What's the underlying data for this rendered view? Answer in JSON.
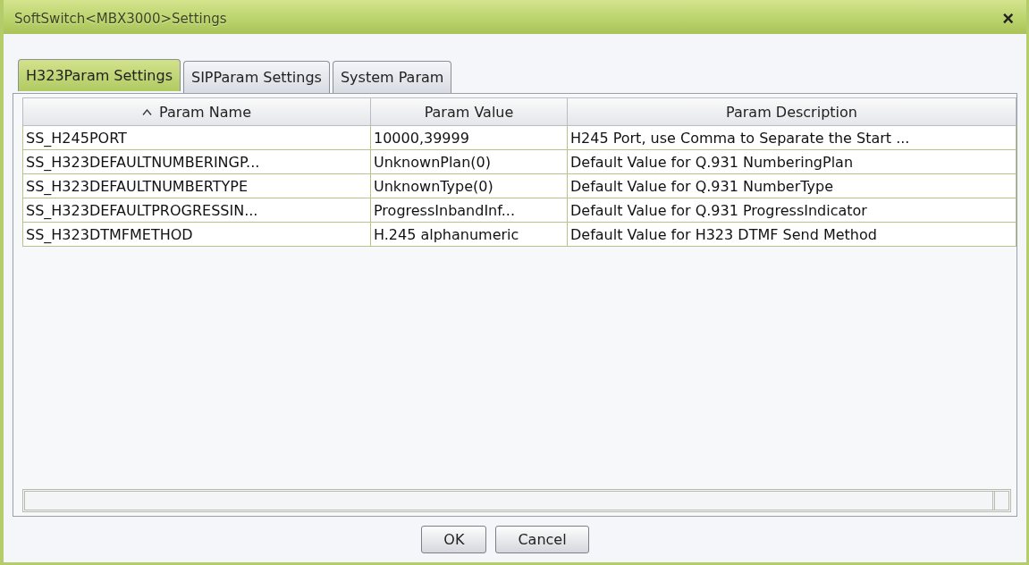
{
  "window": {
    "title": "SoftSwitch<MBX3000>Settings",
    "close": "×"
  },
  "tabs": [
    {
      "label": "H323Param Settings",
      "selected": true
    },
    {
      "label": "SIPParam Settings",
      "selected": false
    },
    {
      "label": "System Param",
      "selected": false
    }
  ],
  "table": {
    "columns": [
      {
        "label": "Param Name",
        "sorted": true
      },
      {
        "label": "Param Value",
        "sorted": false
      },
      {
        "label": "Param Description",
        "sorted": false
      }
    ],
    "rows": [
      [
        "SS_H245PORT",
        "10000,39999",
        "H245 Port, use Comma to Separate the Start ..."
      ],
      [
        "SS_H323DEFAULTNUMBERINGP...",
        "UnknownPlan(0)",
        "Default Value for Q.931 NumberingPlan"
      ],
      [
        "SS_H323DEFAULTNUMBERTYPE",
        "UnknownType(0)",
        "Default Value for Q.931 NumberType"
      ],
      [
        "SS_H323DEFAULTPROGRESSIN...",
        "ProgressInbandInf...",
        "Default Value for Q.931 ProgressIndicator"
      ],
      [
        "SS_H323DTMFMETHOD",
        "H.245 alphanumeric",
        "Default Value for H323 DTMF Send Method"
      ]
    ]
  },
  "buttons": [
    "OK",
    "Cancel"
  ]
}
